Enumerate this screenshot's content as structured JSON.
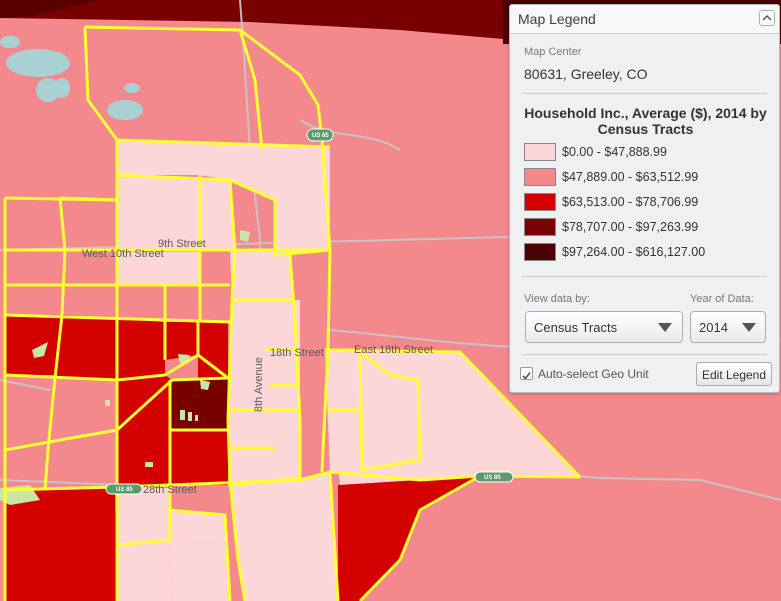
{
  "map": {
    "streets": {
      "ninth": "9th Street",
      "west_tenth": "West 10th Street",
      "eighteenth": "18th Street",
      "east_eighteenth": "East 18th Street",
      "twentyeighth": "28th Street",
      "eighth_ave": "8th Avenue"
    },
    "shields": {
      "us85_top": "US 85",
      "us85_mid": "US 85",
      "us85_bottom": "US 85"
    },
    "colors": {
      "bin0": "#fdd6d7",
      "bin1": "#f3898c",
      "bin2": "#d40000",
      "bin3": "#780000",
      "bin4": "#4a0000",
      "boundary": "#ffff33",
      "road": "#c9c9c9",
      "water": "#a9d1d4",
      "park": "#c8e6a8"
    }
  },
  "legend": {
    "title": "Map Legend",
    "map_center_label": "Map Center",
    "map_center_value": "80631, Greeley, CO",
    "data_title": "Household Inc., Average ($), 2014 by Census Tracts",
    "bins": [
      {
        "label": "$0.00 - $47,888.99",
        "color": "#fdd6d7"
      },
      {
        "label": "$47,889.00 - $63,512.99",
        "color": "#f3898c"
      },
      {
        "label": "$63,513.00 - $78,706.99",
        "color": "#d40000"
      },
      {
        "label": "$78,707.00 - $97,263.99",
        "color": "#780000"
      },
      {
        "label": "$97,264.00 - $616,127.00",
        "color": "#4a0000"
      }
    ],
    "view_by_label": "View data by:",
    "view_by_value": "Census Tracts",
    "year_label": "Year of Data:",
    "year_value": "2014",
    "auto_select_label": "Auto-select Geo Unit",
    "auto_select_checked": true,
    "edit_button": "Edit Legend",
    "collapse_icon": "chevron-up-icon"
  }
}
